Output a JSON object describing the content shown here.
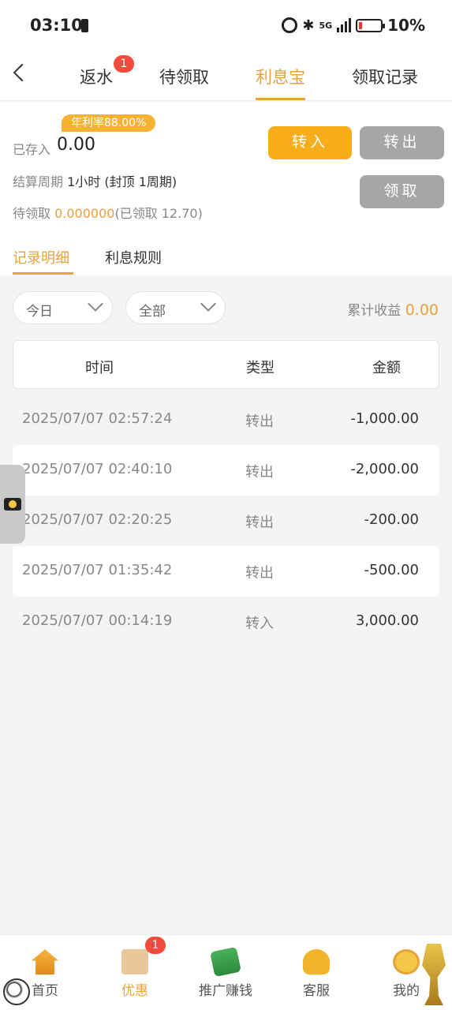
{
  "status_bar": {
    "time": "03:10",
    "network": "5G",
    "battery": "10%"
  },
  "nav": {
    "tabs": [
      {
        "label": "返水",
        "badge": "1"
      },
      {
        "label": "待领取"
      },
      {
        "label": "利息宝",
        "active": true
      },
      {
        "label": "领取记录"
      }
    ]
  },
  "summary": {
    "rate_tag": "年利率88.00%",
    "deposited_label": "已存入",
    "deposited_value": "0.00",
    "cycle_label": "结算周期",
    "cycle_value": "1小时",
    "cycle_cap_open": "(封顶",
    "cycle_cap_value": "1周期",
    "cycle_cap_close": ")",
    "pending_label": "待领取",
    "pending_value": "0.000000",
    "claimed_text": "(已领取 12.70)",
    "btn_in": "转入",
    "btn_out": "转出",
    "btn_claim": "领取"
  },
  "sub_tabs": [
    "记录明细",
    "利息规则"
  ],
  "filters": {
    "date": "今日",
    "type": "全部",
    "cumulative_label": "累计收益",
    "cumulative_value": "0.00"
  },
  "table": {
    "headers": [
      "时间",
      "类型",
      "金额"
    ],
    "rows": [
      {
        "time": "2025/07/07 02:57:24",
        "type": "转出",
        "amount": "-1,000.00"
      },
      {
        "time": "2025/07/07 02:40:10",
        "type": "转出",
        "amount": "-2,000.00"
      },
      {
        "time": "2025/07/07 02:20:25",
        "type": "转出",
        "amount": "-200.00"
      },
      {
        "time": "2025/07/07 01:35:42",
        "type": "转出",
        "amount": "-500.00"
      },
      {
        "time": "2025/07/07 00:14:19",
        "type": "转入",
        "amount": "3,000.00"
      }
    ]
  },
  "tabbar": {
    "items": [
      {
        "label": "首页",
        "icon": "home-icon"
      },
      {
        "label": "优惠",
        "icon": "gift-icon",
        "badge": "1",
        "active": true
      },
      {
        "label": "推广赚钱",
        "icon": "money-icon"
      },
      {
        "label": "客服",
        "icon": "service-icon"
      },
      {
        "label": "我的",
        "icon": "mine-icon"
      }
    ]
  }
}
